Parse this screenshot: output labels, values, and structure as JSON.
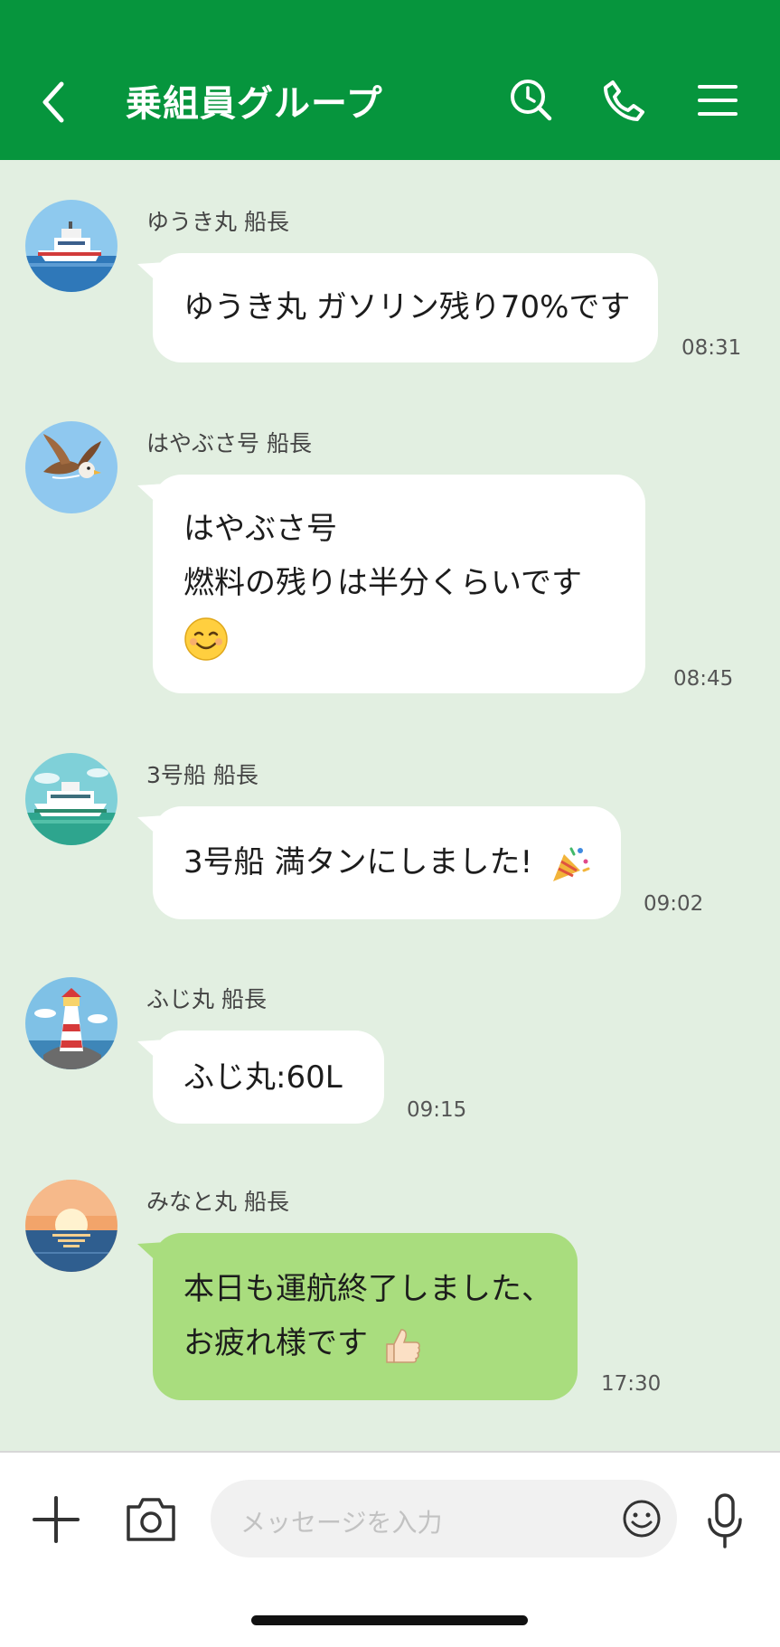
{
  "header": {
    "title": "乗組員グループ",
    "icons": [
      "back-chevron-icon",
      "search-icon",
      "phone-icon",
      "menu-icon"
    ]
  },
  "messages": [
    {
      "sender": "ゆうき丸 船長",
      "avatar": "ship-avatar",
      "lines": [
        "ゆうき丸 ガソリン残り70%です"
      ],
      "time": "08:31",
      "bubble_color": "#ffffff"
    },
    {
      "sender": "はやぶさ号 船長",
      "avatar": "falcon-avatar",
      "lines": [
        "はやぶさ号",
        "燃料の残りは半分くらいです"
      ],
      "emoji": "smiling-face-emoji",
      "time": "08:45",
      "bubble_color": "#ffffff"
    },
    {
      "sender": "3号船 船長",
      "avatar": "ferry-avatar",
      "lines": [
        "3号船 満タンにしました!"
      ],
      "emoji": "party-popper-emoji",
      "time": "09:02",
      "bubble_color": "#ffffff"
    },
    {
      "sender": "ふじ丸 船長",
      "avatar": "lighthouse-avatar",
      "lines": [
        "ふじ丸:60L"
      ],
      "time": "09:15",
      "bubble_color": "#ffffff"
    },
    {
      "sender": "みなと丸 船長",
      "avatar": "sunset-avatar",
      "lines": [
        "本日も運航終了しました、",
        "お疲れ様です"
      ],
      "emoji": "thumbs-up-emoji",
      "time": "17:30",
      "bubble_color": "#a9dd7e"
    }
  ],
  "input": {
    "placeholder": "メッセージを入力",
    "icons": [
      "plus-icon",
      "camera-icon",
      "emoji-icon",
      "microphone-icon"
    ]
  },
  "colors": {
    "header": "#06953d",
    "background": "#e2efe1",
    "bubble": "#ffffff",
    "bubble_green": "#a9dd7e"
  }
}
